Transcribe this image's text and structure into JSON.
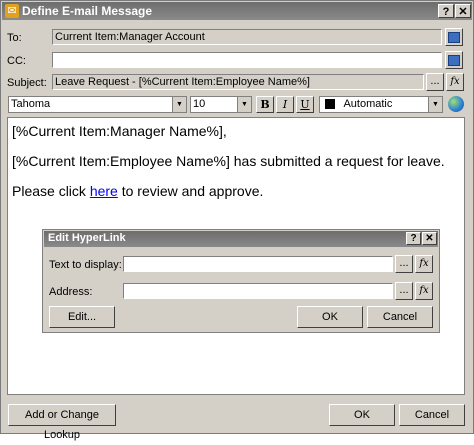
{
  "window": {
    "title": "Define E-mail Message",
    "help_label": "?",
    "close_label": "✕"
  },
  "to": {
    "label": "To:",
    "value": "Current Item:Manager Account"
  },
  "cc": {
    "label": "CC:",
    "value": ""
  },
  "subject": {
    "label": "Subject:",
    "value": "Leave Request - [%Current Item:Employee Name%]",
    "ellipsis_label": "...",
    "fx_label": "fx"
  },
  "toolbar": {
    "font": "Tahoma",
    "size": "10",
    "bold_label": "B",
    "italic_label": "I",
    "underline_label": "U",
    "color_name": "Automatic",
    "color_swatch": "#000000"
  },
  "body": {
    "line1": "[%Current Item:Manager Name%],",
    "line2": "[%Current Item:Employee Name%] has submitted a request for leave.",
    "line3_prefix": "Please click ",
    "line3_link": "here",
    "line3_suffix": " to review and approve."
  },
  "hyperlink_dialog": {
    "title": "Edit HyperLink",
    "help_label": "?",
    "close_label": "✕",
    "text_label": "Text to display:",
    "text_value": "",
    "address_label": "Address:",
    "address_value": "",
    "ellipsis_label": "...",
    "fx_label": "fx",
    "edit_label": "Edit...",
    "ok_label": "OK",
    "cancel_label": "Cancel"
  },
  "footer": {
    "lookup_label": "Add or Change Lookup",
    "ok_label": "OK",
    "cancel_label": "Cancel"
  }
}
